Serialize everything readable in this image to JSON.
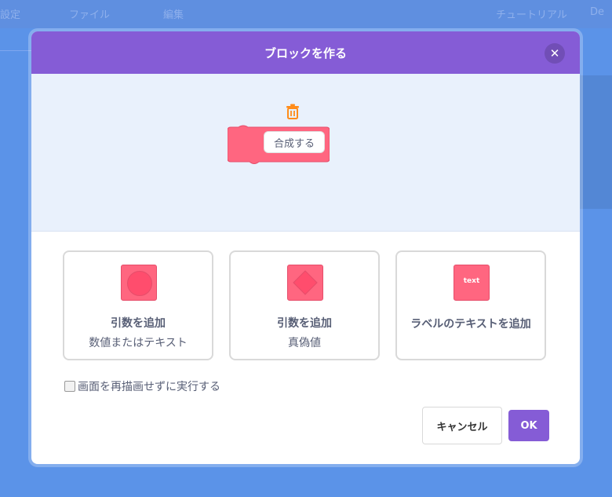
{
  "background_menu": {
    "items": [
      "設定",
      "ファイル",
      "編集",
      "チュートリアル",
      "De"
    ]
  },
  "modal": {
    "title": "ブロックを作る",
    "close_icon": "close-icon",
    "block_name_value": "合成する",
    "options": [
      {
        "title": "引数を追加",
        "subtitle": "数値またはテキスト",
        "icon": "round-input-icon"
      },
      {
        "title": "引数を追加",
        "subtitle": "真偽値",
        "icon": "boolean-input-icon"
      },
      {
        "title": "ラベルのテキストを追加",
        "subtitle": "",
        "icon": "label-text-icon",
        "icon_text": "text"
      }
    ],
    "run_without_refresh_label": "画面を再描画せずに実行する",
    "run_without_refresh_checked": false,
    "cancel_label": "キャンセル",
    "ok_label": "OK"
  },
  "colors": {
    "header": "#855cd6",
    "block": "#ff6680",
    "workspace": "#e9f1fc",
    "backdrop": "#5b93e8"
  }
}
